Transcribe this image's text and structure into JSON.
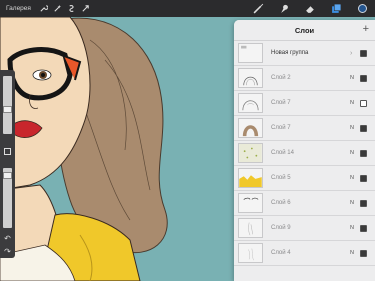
{
  "toolbar": {
    "gallery_label": "Галерея",
    "left_tools": [
      "wrench-icon",
      "magic-wand-icon",
      "selection-icon",
      "transform-icon"
    ],
    "right_tools": [
      "brush-icon",
      "smudge-icon",
      "eraser-icon",
      "layers-icon"
    ],
    "color": "#24558f"
  },
  "layers_panel": {
    "title": "Слои",
    "add_label": "+",
    "layers": [
      {
        "name": "Новая группа",
        "blend": "",
        "visible": true,
        "group": true,
        "thumb": "group"
      },
      {
        "name": "Слой 2",
        "blend": "N",
        "visible": true,
        "group": false,
        "thumb": "hair"
      },
      {
        "name": "Слой 7",
        "blend": "N",
        "visible": false,
        "group": false,
        "thumb": "hair-outline"
      },
      {
        "name": "Слой 7",
        "blend": "N",
        "visible": true,
        "group": false,
        "thumb": "hair-brown"
      },
      {
        "name": "Слой 14",
        "blend": "N",
        "visible": true,
        "group": false,
        "thumb": "dots"
      },
      {
        "name": "Слой 5",
        "blend": "N",
        "visible": true,
        "group": false,
        "thumb": "yellow"
      },
      {
        "name": "Слой 6",
        "blend": "N",
        "visible": true,
        "group": false,
        "thumb": "eyes"
      },
      {
        "name": "Слой 9",
        "blend": "N",
        "visible": true,
        "group": false,
        "thumb": "sketch"
      },
      {
        "name": "Слой 4",
        "blend": "N",
        "visible": true,
        "group": false,
        "thumb": "sketch2"
      }
    ]
  },
  "colors": {
    "background": "#79b1b3",
    "skin": "#f3d9b8",
    "hair": "#a98b6e",
    "jacket": "#f0c82a",
    "lips": "#c8262c",
    "glasses": "#151515"
  }
}
